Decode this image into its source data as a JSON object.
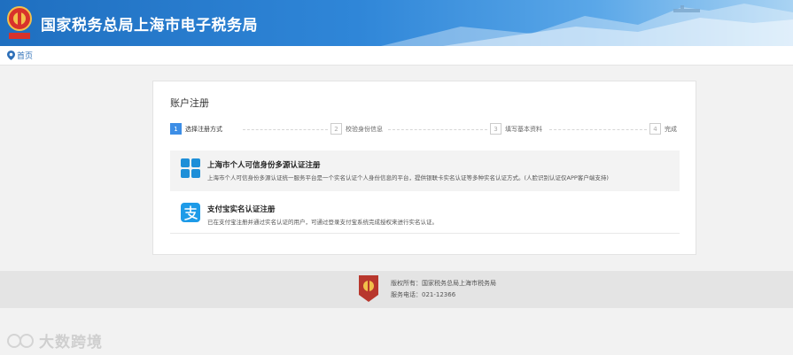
{
  "header": {
    "site_title": "国家税务总局上海市电子税务局"
  },
  "breadcrumb": {
    "home": "首页"
  },
  "card": {
    "title": "账户注册",
    "steps": [
      {
        "num": "1",
        "label": "选择注册方式",
        "active": true
      },
      {
        "num": "2",
        "label": "校验身份信息",
        "active": false
      },
      {
        "num": "3",
        "label": "填写基本资料",
        "active": false
      },
      {
        "num": "4",
        "label": "完成",
        "active": false
      }
    ],
    "options": [
      {
        "icon": "grid-apps-icon",
        "name": "上海市个人可信身份多源认证注册",
        "desc": "上海市个人可信身份多源认证统一服务平台是一个实名认证个人身份信息的平台，提供银联卡实名认证等多种实名认证方式。(人脸识别认证仅APP客户端支持)"
      },
      {
        "icon": "alipay-icon",
        "name": "支付宝实名认证注册",
        "desc": "已在支付宝注册并通过实名认证的用户，可通过登录支付宝系统完成授权来进行实名认证。"
      }
    ]
  },
  "footer": {
    "copyright": "版权所有：国家税务总局上海市税务局",
    "phone": "服务电话：021-12366"
  },
  "watermark": {
    "text": "大数跨境"
  },
  "colors": {
    "accent": "#3d8ee6",
    "header_start": "#1f6fc0",
    "alipay": "#1e9be8"
  }
}
